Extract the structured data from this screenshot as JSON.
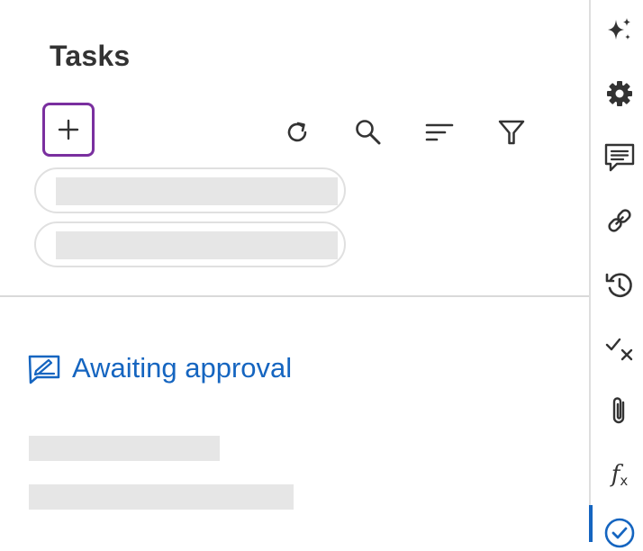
{
  "header": {
    "title": "Tasks"
  },
  "toolbar": {
    "add_icon": "plus-icon",
    "refresh_icon": "refresh-icon",
    "search_icon": "search-icon",
    "sort_icon": "sort-icon",
    "filter_icon": "filter-icon",
    "accent": "#7a2f9f"
  },
  "filters": [
    {
      "value": ""
    },
    {
      "value": ""
    }
  ],
  "section": {
    "label": "Awaiting approval",
    "icon": "approval-sign-icon",
    "color": "#1565c0"
  },
  "rail": {
    "items": [
      {
        "icon": "sparkle-icon"
      },
      {
        "icon": "gear-icon"
      },
      {
        "icon": "comment-icon"
      },
      {
        "icon": "link-icon"
      },
      {
        "icon": "history-icon"
      },
      {
        "icon": "check-cross-icon"
      },
      {
        "icon": "paperclip-icon"
      },
      {
        "icon": "formula-icon",
        "label": "f",
        "sub": "x"
      },
      {
        "icon": "task-check-icon",
        "active": true
      }
    ]
  }
}
